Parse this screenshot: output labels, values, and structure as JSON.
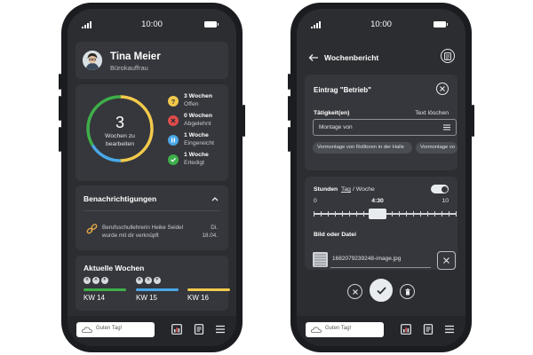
{
  "status": {
    "time": "10:00"
  },
  "left_screen": {
    "profile": {
      "name": "Tina Meier",
      "role": "Bürokauffrau"
    },
    "summary": {
      "count": "3",
      "label_line1": "Wochen zu",
      "label_line2": "bearbeiten",
      "legend": [
        {
          "title": "3 Wochen",
          "status": "Offen",
          "color": "#f2c94c",
          "icon": "question-icon"
        },
        {
          "title": "0 Wochen",
          "status": "Abgelehnt",
          "color": "#e04b4b",
          "icon": "close-icon"
        },
        {
          "title": "1 Woche",
          "status": "Eingereicht",
          "color": "#4aa8e8",
          "icon": "pause-icon"
        },
        {
          "title": "1 Woche",
          "status": "Erledigt",
          "color": "#3fae4a",
          "icon": "check-icon"
        }
      ],
      "ring_segments": [
        {
          "color": "#f2c94c",
          "fraction": 0.5
        },
        {
          "color": "#4aa8e8",
          "fraction": 0.1667
        },
        {
          "color": "#3fae4a",
          "fraction": 0.3333
        }
      ]
    },
    "notifications": {
      "title": "Benachrichtigungen",
      "item": {
        "text_line1": "Berufsschullehrerin Heike Seidel",
        "text_line2": "wurde mit dir verknüpft",
        "date_line1": "Di.",
        "date_line2": "18.04."
      }
    },
    "weeks": {
      "title": "Aktuelle Wochen",
      "items": [
        {
          "label": "KW 14",
          "days": [
            "S",
            "A",
            "F"
          ],
          "color": "#3fae4a"
        },
        {
          "label": "KW 15",
          "days": [
            "B",
            "S",
            "F"
          ],
          "color": "#4aa8e8"
        },
        {
          "label": "KW 16",
          "days": [],
          "color": "#f2c94c"
        }
      ]
    },
    "tabbar": {
      "greeting": "Guten Tag!"
    }
  },
  "right_screen": {
    "header": {
      "title": "Wochenbericht"
    },
    "entry": {
      "title": "Eintrag \"Betrieb\"",
      "activities_label": "Tätigkeit(en)",
      "clear_text": "Text löschen",
      "select_value": "Montage von",
      "chips": [
        "Vormontage von Rolltoren in der Halle",
        "Vormontage vo"
      ]
    },
    "hours": {
      "label_hours": "Stunden",
      "label_day": "Tag",
      "label_week": "/ Woche",
      "min": "0",
      "max": "10",
      "value_text": "4:30",
      "value": 4.5,
      "range": [
        0,
        10
      ]
    },
    "file": {
      "label": "Bild oder Datei",
      "filename": "1682079239248-image.jpg"
    },
    "tabbar": {
      "greeting": "Guten Tag!"
    }
  }
}
